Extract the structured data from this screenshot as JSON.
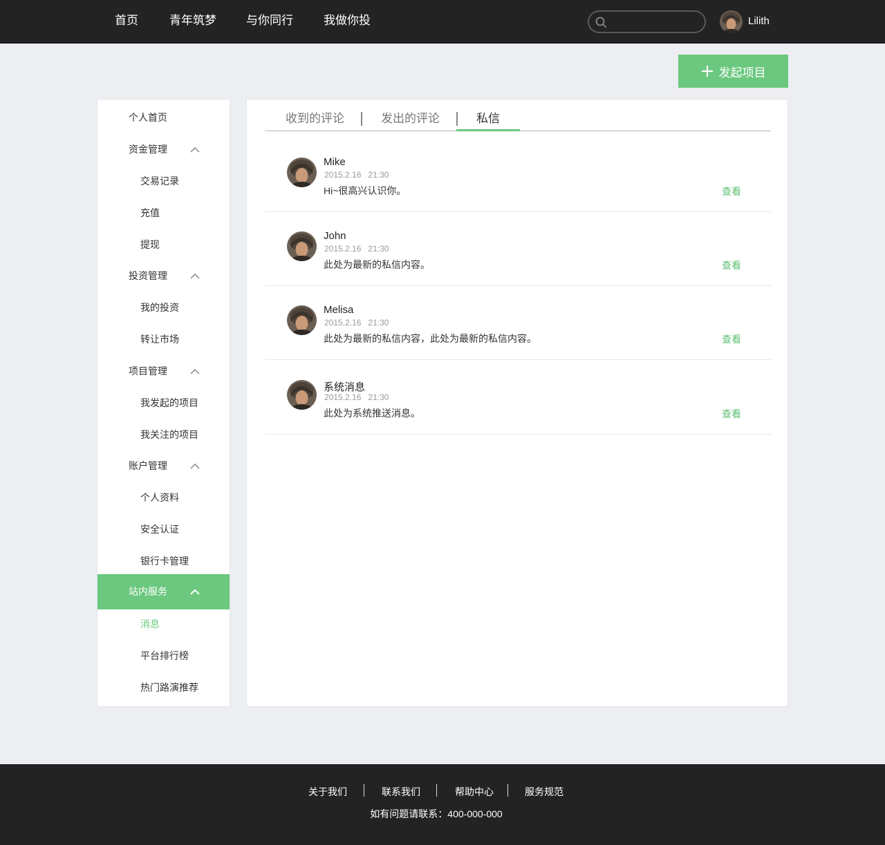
{
  "nav": {
    "items": [
      "首页",
      "青年筑梦",
      "与你同行",
      "我做你投"
    ],
    "search_value": "",
    "user_name": "Lilith"
  },
  "launch_button": {
    "label": "发起项目"
  },
  "sidebar": {
    "rows": [
      {
        "label": "个人首页",
        "kind": "group",
        "chevron": false
      },
      {
        "label": "资金管理",
        "kind": "group",
        "chevron": true
      },
      {
        "label": "交易记录",
        "kind": "sub"
      },
      {
        "label": "充值",
        "kind": "sub"
      },
      {
        "label": "提现",
        "kind": "sub"
      },
      {
        "label": "投资管理",
        "kind": "group",
        "chevron": true
      },
      {
        "label": "我的投资",
        "kind": "sub"
      },
      {
        "label": "转让市场",
        "kind": "sub"
      },
      {
        "label": "项目管理",
        "kind": "group",
        "chevron": true
      },
      {
        "label": "我发起的项目",
        "kind": "sub"
      },
      {
        "label": "我关注的项目",
        "kind": "sub"
      },
      {
        "label": "账户管理",
        "kind": "group",
        "chevron": true
      },
      {
        "label": "个人资料",
        "kind": "sub"
      },
      {
        "label": "安全认证",
        "kind": "sub"
      },
      {
        "label": "银行卡管理",
        "kind": "sub"
      },
      {
        "label": "站内服务",
        "kind": "group",
        "chevron": true,
        "active": true
      },
      {
        "label": "消息",
        "kind": "sub",
        "active": true
      },
      {
        "label": "平台排行榜",
        "kind": "sub"
      },
      {
        "label": "热门路演推荐",
        "kind": "sub"
      }
    ]
  },
  "tabs": [
    {
      "label": "收到的评论",
      "active": false
    },
    {
      "label": "发出的评论",
      "active": false
    },
    {
      "label": "私信",
      "active": true
    }
  ],
  "messages": [
    {
      "sender": "Mike",
      "date": "2015.2.16",
      "time": "21:30",
      "content": "Hi~很高兴认识你。",
      "action": "查看"
    },
    {
      "sender": "John",
      "date": "2015.2.16",
      "time": "21:30",
      "content": "此处为最新的私信内容。",
      "action": "查看"
    },
    {
      "sender": "Melisa",
      "date": "2015.2.16",
      "time": "21:30",
      "content": "此处为最新的私信内容，此处为最新的私信内容。",
      "action": "查看"
    },
    {
      "sender": "系统消息",
      "date": "2015.2.16",
      "time": "21:30",
      "content": "此处为系统推送消息。",
      "action": "查看"
    }
  ],
  "footer": {
    "links": [
      "关于我们",
      "联系我们",
      "帮助中心",
      "服务规范"
    ],
    "contact": "如有问题请联系：400-000-000"
  },
  "colors": {
    "accent": "#6bc87e",
    "topbar": "#232323",
    "page_bg": "#eceef1"
  }
}
